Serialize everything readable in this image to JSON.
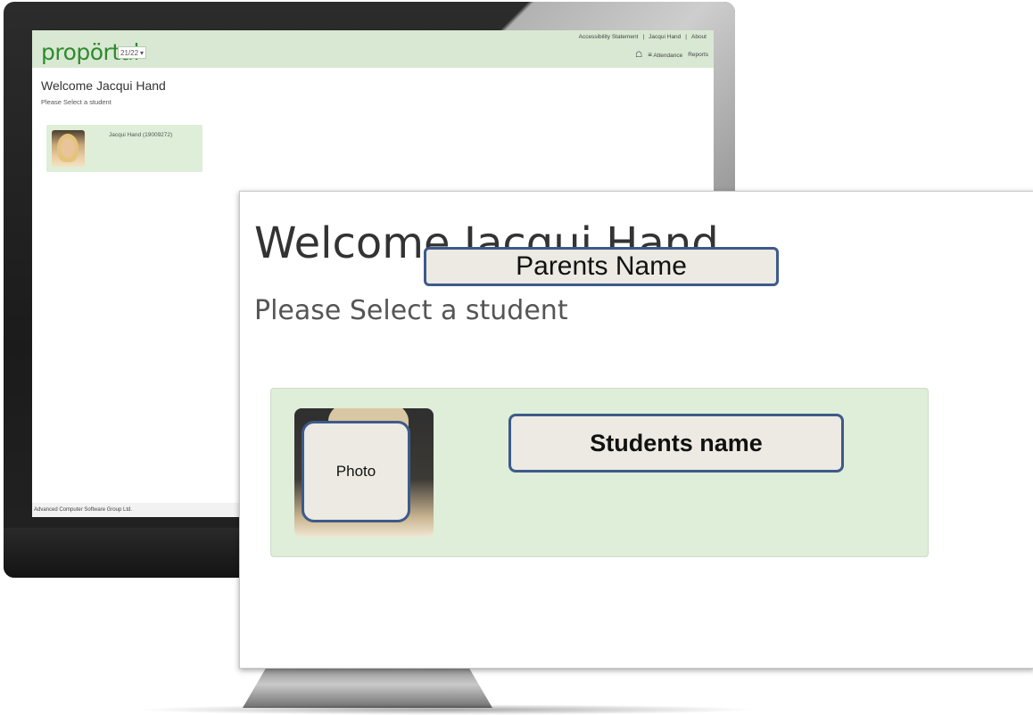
{
  "header": {
    "logo": "propörtal",
    "year_select": "21/22",
    "top_links": [
      "Accessibility Statement",
      "|",
      "Jacqui Hand",
      "|",
      "About"
    ],
    "nav": {
      "attendance": "Attendance",
      "reports": "Reports"
    }
  },
  "main": {
    "welcome": "Welcome Jacqui Hand",
    "subtitle": "Please Select a student",
    "student": {
      "name": "Jacqui Hand (19009272)"
    }
  },
  "footer": {
    "text": "Advanced Computer Software Group Ltd."
  },
  "zoom": {
    "welcome": "Welcome Jacqui Hand",
    "subtitle": "Please Select a student",
    "callout_parent": "Parents Name",
    "callout_photo": "Photo",
    "callout_student": "Students name"
  },
  "icons": {
    "home": "home-icon",
    "menu": "list-icon",
    "dropdown": "chevron-down-icon"
  },
  "colors": {
    "topbar": "#d9e8d3",
    "card": "#deeed9",
    "logo": "#2e8b2e",
    "callout_border": "#3d5a8a"
  }
}
